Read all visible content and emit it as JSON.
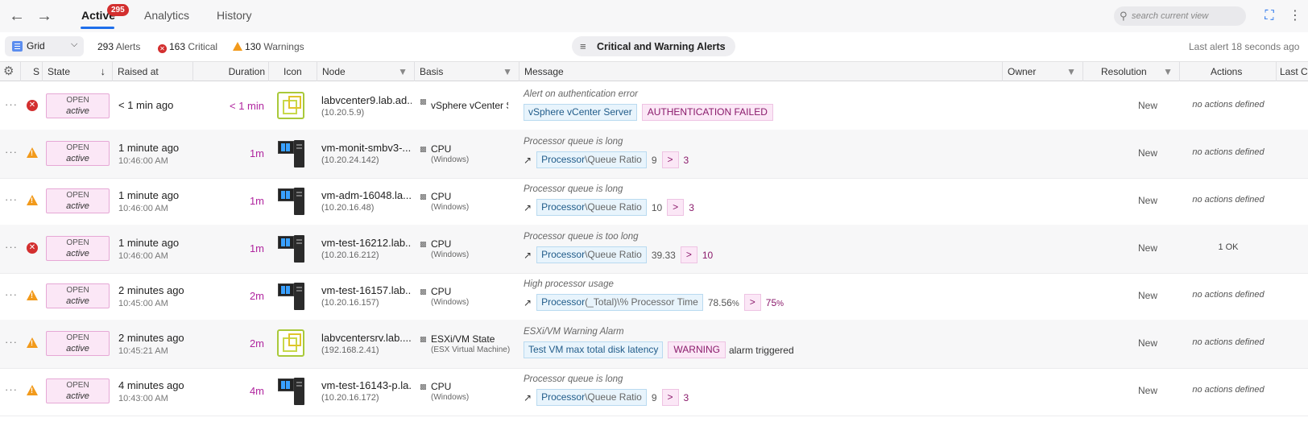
{
  "nav": {
    "back_icon": "arrow-left-icon",
    "forward_icon": "arrow-right-icon"
  },
  "tabs": [
    {
      "label": "Active",
      "badge": "295"
    },
    {
      "label": "Analytics"
    },
    {
      "label": "History"
    }
  ],
  "search": {
    "placeholder": "search current view"
  },
  "toolbar": {
    "view_label": "Grid",
    "alerts_count": "293",
    "alerts_label": "Alerts",
    "critical_count": "163",
    "critical_label": "Critical",
    "warnings_count": "130",
    "warnings_label": "Warnings",
    "filter_label": "Critical and Warning Alerts",
    "last_alert": "Last alert 18 seconds ago"
  },
  "columns": {
    "s": "S",
    "state": "State",
    "raised": "Raised at",
    "duration": "Duration",
    "icon": "Icon",
    "node": "Node",
    "basis": "Basis",
    "message": "Message",
    "owner": "Owner",
    "resolution": "Resolution",
    "actions": "Actions",
    "last": "Last Ca"
  },
  "colors": {
    "accent": "#1f6feb",
    "critical": "#d32f2f",
    "warning": "#f29a1b",
    "state_bg": "#fbe7f6"
  },
  "rows": [
    {
      "severity": "critical",
      "state1": "OPEN",
      "state2": "active",
      "raised1": "< 1 min ago",
      "raised2": "",
      "duration": "< 1 min",
      "icon": "vm",
      "node1": "labvcenter9.lab.ad...",
      "node2": "(10.20.5.9)",
      "basis1": "vSphere vCenter S...",
      "basis2": "",
      "msg_title": "Alert on authentication error",
      "msg_kind": "pair",
      "chip1": "vSphere vCenter Server",
      "chip2": "AUTHENTICATION FAILED",
      "tail": "",
      "resolution": "New",
      "actions": "no actions defined"
    },
    {
      "severity": "warning",
      "state1": "OPEN",
      "state2": "active",
      "raised1": "1 minute ago",
      "raised2": "10:46:00 AM",
      "duration": "1m",
      "icon": "pc",
      "node1": "vm-monit-smbv3-...",
      "node2": "(10.20.24.142)",
      "basis1": "CPU",
      "basis2": "(Windows)",
      "msg_title": "Processor queue is long",
      "msg_kind": "metric",
      "metric_a": "Processor",
      "metric_b": "\\Queue Ratio",
      "value": "9",
      "unit": "",
      "op": ">",
      "threshold": "3",
      "threshold_unit": "",
      "resolution": "New",
      "actions": "no actions defined"
    },
    {
      "severity": "warning",
      "state1": "OPEN",
      "state2": "active",
      "raised1": "1 minute ago",
      "raised2": "10:46:00 AM",
      "duration": "1m",
      "icon": "pc",
      "node1": "vm-adm-16048.la...",
      "node2": "(10.20.16.48)",
      "basis1": "CPU",
      "basis2": "(Windows)",
      "msg_title": "Processor queue is long",
      "msg_kind": "metric",
      "metric_a": "Processor",
      "metric_b": "\\Queue Ratio",
      "value": "10",
      "unit": "",
      "op": ">",
      "threshold": "3",
      "threshold_unit": "",
      "resolution": "New",
      "actions": "no actions defined"
    },
    {
      "severity": "critical",
      "state1": "OPEN",
      "state2": "active",
      "raised1": "1 minute ago",
      "raised2": "10:46:00 AM",
      "duration": "1m",
      "icon": "pc",
      "node1": "vm-test-16212.lab....",
      "node2": "(10.20.16.212)",
      "basis1": "CPU",
      "basis2": "(Windows)",
      "msg_title": "Processor queue is too long",
      "msg_kind": "metric",
      "metric_a": "Processor",
      "metric_b": "\\Queue Ratio",
      "value": "39.33",
      "unit": "",
      "op": ">",
      "threshold": "10",
      "threshold_unit": "",
      "resolution": "New",
      "actions": "1 OK"
    },
    {
      "severity": "warning",
      "state1": "OPEN",
      "state2": "active",
      "raised1": "2 minutes ago",
      "raised2": "10:45:00 AM",
      "duration": "2m",
      "icon": "pc",
      "node1": "vm-test-16157.lab....",
      "node2": "(10.20.16.157)",
      "basis1": "CPU",
      "basis2": "(Windows)",
      "msg_title": "High processor usage",
      "msg_kind": "metric",
      "metric_a": "Processor",
      "metric_b": "(_Total)\\% Processor Time",
      "value": "78.56",
      "unit": "%",
      "op": ">",
      "threshold": "75",
      "threshold_unit": "%",
      "resolution": "New",
      "actions": "no actions defined"
    },
    {
      "severity": "warning",
      "state1": "OPEN",
      "state2": "active",
      "raised1": "2 minutes ago",
      "raised2": "10:45:21 AM",
      "duration": "2m",
      "icon": "vm",
      "node1": "labvcentersrv.lab....",
      "node2": "(192.168.2.41)",
      "basis1": "ESXi/VM State",
      "basis2": "(ESX Virtual Machine)",
      "msg_title": "ESXi/VM Warning Alarm",
      "msg_kind": "pair",
      "chip1": "Test VM max total disk latency",
      "chip2": "WARNING",
      "tail": "alarm triggered",
      "resolution": "New",
      "actions": "no actions defined"
    },
    {
      "severity": "warning",
      "state1": "OPEN",
      "state2": "active",
      "raised1": "4 minutes ago",
      "raised2": "10:43:00 AM",
      "duration": "4m",
      "icon": "pc",
      "node1": "vm-test-16143-p.la...",
      "node2": "(10.20.16.172)",
      "basis1": "CPU",
      "basis2": "(Windows)",
      "msg_title": "Processor queue is long",
      "msg_kind": "metric",
      "metric_a": "Processor",
      "metric_b": "\\Queue Ratio",
      "value": "9",
      "unit": "",
      "op": ">",
      "threshold": "3",
      "threshold_unit": "",
      "resolution": "New",
      "actions": "no actions defined"
    }
  ]
}
